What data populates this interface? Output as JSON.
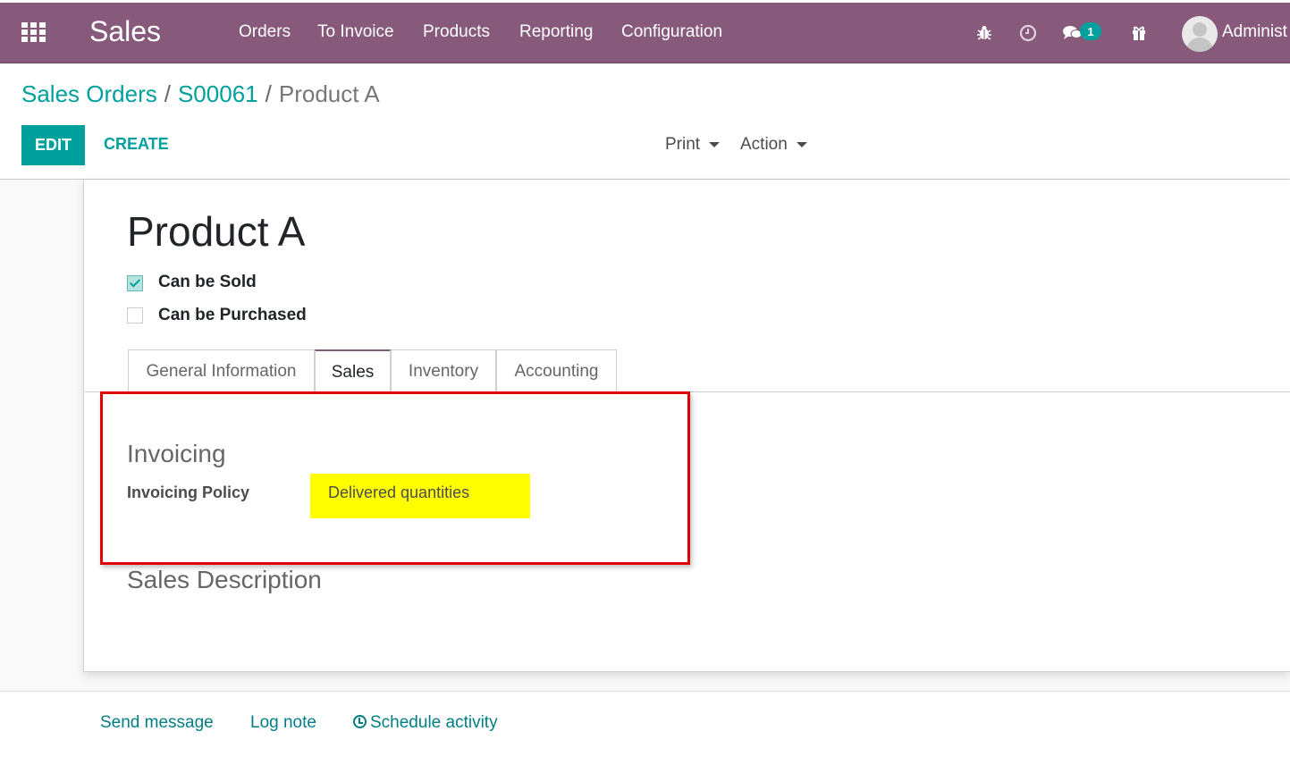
{
  "navbar": {
    "app_title": "Sales",
    "menu": [
      "Orders",
      "To Invoice",
      "Products",
      "Reporting",
      "Configuration"
    ],
    "icons": [
      "bug-icon",
      "clock-icon",
      "chat-icon",
      "gift-icon"
    ],
    "message_count": "1",
    "user_name": "Administ",
    "color": "#875a7b"
  },
  "breadcrumb": {
    "items": [
      "Sales Orders",
      "S00061"
    ],
    "separator": "/",
    "current": "Product A"
  },
  "toolbar": {
    "edit_label": "EDIT",
    "create_label": "CREATE",
    "print_label": "Print",
    "action_label": "Action"
  },
  "product": {
    "name": "Product A",
    "can_be_sold_label": "Can be Sold",
    "can_be_sold": true,
    "can_be_purchased_label": "Can be Purchased",
    "can_be_purchased": false
  },
  "tabs": [
    {
      "label": "General Information",
      "active": false
    },
    {
      "label": "Sales",
      "active": true
    },
    {
      "label": "Inventory",
      "active": false
    },
    {
      "label": "Accounting",
      "active": false
    }
  ],
  "sales_tab": {
    "invoicing_title": "Invoicing",
    "invoicing_policy_label": "Invoicing Policy",
    "invoicing_policy_value": "Delivered quantities",
    "description_title": "Sales Description"
  },
  "chatter": {
    "send_message": "Send message",
    "log_note": "Log note",
    "schedule_activity": "Schedule activity"
  },
  "colors": {
    "accent": "#00a09d",
    "highlight": "#ffff00",
    "annotation": "#e10000"
  }
}
